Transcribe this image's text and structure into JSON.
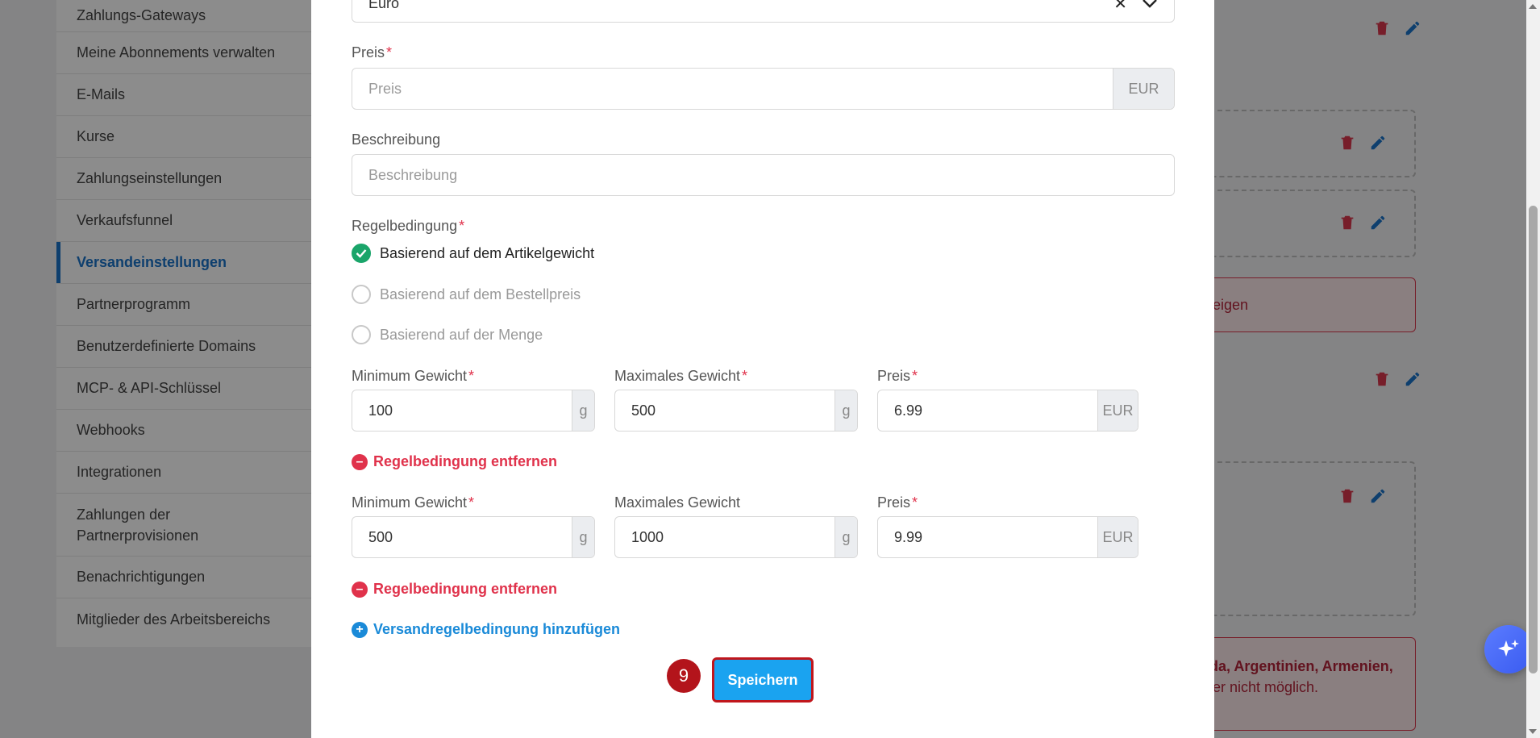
{
  "sidebar": {
    "items": [
      {
        "label": "Zahlungs-Gateways"
      },
      {
        "label": "Meine Abonnements verwalten"
      },
      {
        "label": "E-Mails"
      },
      {
        "label": "Kurse"
      },
      {
        "label": "Zahlungseinstellungen"
      },
      {
        "label": "Verkaufsfunnel"
      },
      {
        "label": "Versandeinstellungen"
      },
      {
        "label": "Partnerprogramm"
      },
      {
        "label": "Benutzerdefinierte Domains"
      },
      {
        "label": "MCP- & API-Schlüssel"
      },
      {
        "label": "Webhooks"
      },
      {
        "label": "Integrationen"
      },
      {
        "label": "Zahlungen der Partnerprovisionen"
      },
      {
        "label": "Benachrichtigungen"
      },
      {
        "label": "Mitglieder des Arbeitsbereichs"
      }
    ]
  },
  "background": {
    "red_box_1": "eigen",
    "red_box_2_line1": "da, Argentinien, Armenien,",
    "red_box_2_line2": "ler nicht möglich."
  },
  "modal": {
    "currency_select": {
      "value": "Euro"
    },
    "price": {
      "label": "Preis",
      "placeholder": "Preis",
      "addon": "EUR"
    },
    "description": {
      "label": "Beschreibung",
      "placeholder": "Beschreibung"
    },
    "rule_condition": {
      "label": "Regelbedingung",
      "options": [
        {
          "label": "Basierend auf dem Artikelgewicht",
          "checked": true
        },
        {
          "label": "Basierend auf dem Bestellpreis",
          "checked": false
        },
        {
          "label": "Basierend auf der Menge",
          "checked": false
        }
      ]
    },
    "rules": [
      {
        "min_label": "Minimum Gewicht",
        "min_required": true,
        "min_value": "100",
        "min_unit": "g",
        "max_label": "Maximales Gewicht",
        "max_required": true,
        "max_value": "500",
        "max_unit": "g",
        "price_label": "Preis",
        "price_value": "6.99",
        "price_unit": "EUR",
        "remove_label": "Regelbedingung entfernen"
      },
      {
        "min_label": "Minimum Gewicht",
        "min_required": true,
        "min_value": "500",
        "min_unit": "g",
        "max_label": "Maximales Gewicht",
        "max_required": false,
        "max_value": "1000",
        "max_unit": "g",
        "price_label": "Preis",
        "price_value": "9.99",
        "price_unit": "EUR",
        "remove_label": "Regelbedingung entfernen"
      }
    ],
    "add_rule_label": "Versandregelbedingung hinzufügen",
    "step_badge": "9",
    "save_label": "Speichern"
  },
  "colors": {
    "accent": "#1a73c9",
    "required": "#e0324b",
    "checked": "#1aa56a",
    "save": "#1aa3f0",
    "highlight": "#c0161c"
  }
}
